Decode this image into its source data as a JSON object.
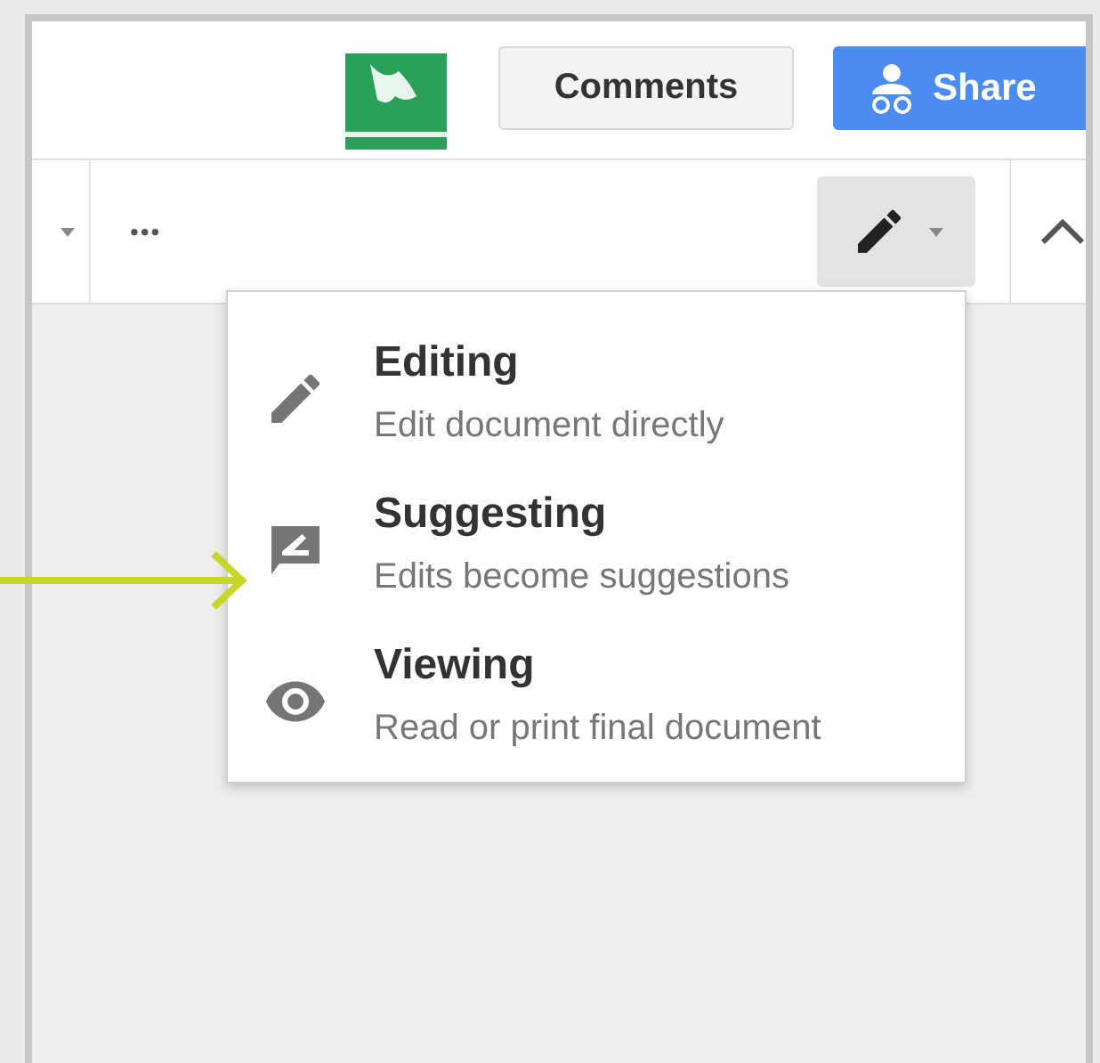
{
  "header": {
    "comments_button": "Comments",
    "share_button": "Share"
  },
  "toolbar": {
    "overflow": "•••"
  },
  "mode_menu": {
    "items": [
      {
        "kind": "editing",
        "title": "Editing",
        "description": "Edit document directly"
      },
      {
        "kind": "suggesting",
        "title": "Suggesting",
        "description": "Edits become suggestions"
      },
      {
        "kind": "viewing",
        "title": "Viewing",
        "description": "Read or print final document"
      }
    ]
  }
}
